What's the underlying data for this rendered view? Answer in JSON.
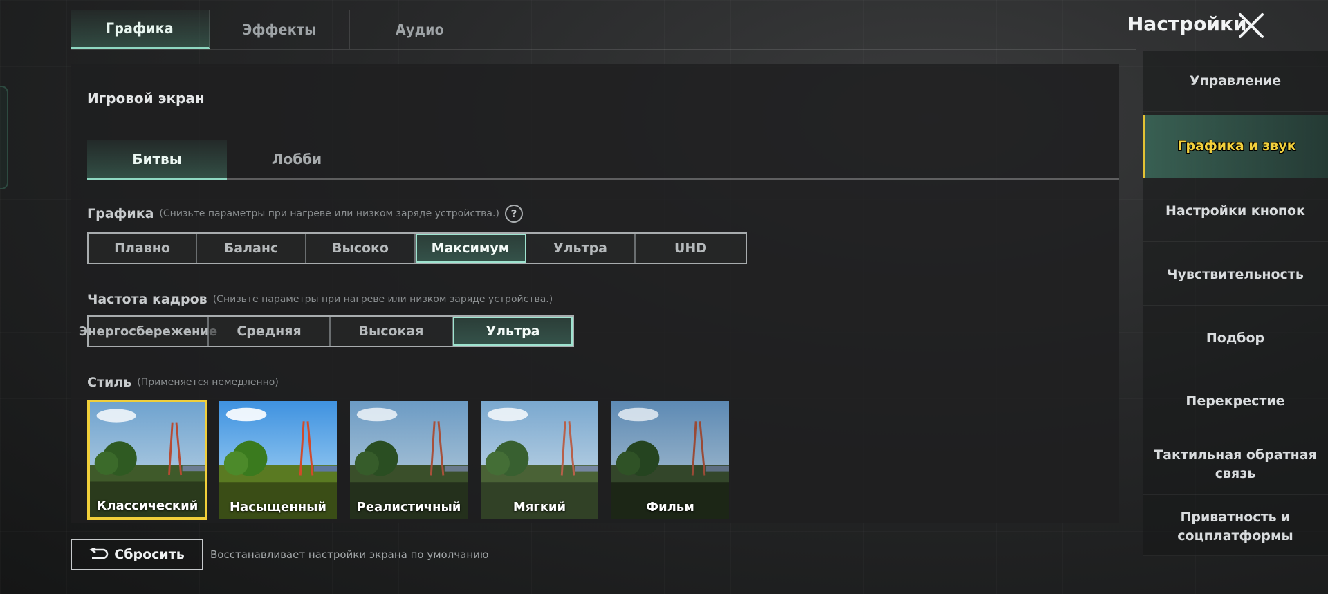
{
  "top_tabs": [
    {
      "label": "Графика",
      "active": true
    },
    {
      "label": "Эффекты",
      "active": false
    },
    {
      "label": "Аудио",
      "active": false
    }
  ],
  "header": {
    "title": "Настройки",
    "close_icon": "close-icon"
  },
  "panel": {
    "section_title": "Игровой экран",
    "sub_tabs": [
      {
        "label": "Битвы",
        "active": true
      },
      {
        "label": "Лобби",
        "active": false
      }
    ],
    "graphics": {
      "label": "Графика",
      "hint": "(Снизьте параметры при нагреве или низком заряде устройства.)",
      "options": [
        "Плавно",
        "Баланс",
        "Высоко",
        "Максимум",
        "Ультра",
        "UHD"
      ],
      "selected": "Максимум"
    },
    "fps": {
      "label": "Частота кадров",
      "hint": "(Снизьте параметры при нагреве или низком заряде устройства.)",
      "options": [
        "Энергосбережение",
        "Средняя",
        "Высокая",
        "Ультра"
      ],
      "selected": "Ультра"
    },
    "style": {
      "label": "Стиль",
      "hint": "(Применяется немедленно)",
      "options": [
        "Классический",
        "Насыщенный",
        "Реалистичный",
        "Мягкий",
        "Фильм"
      ],
      "selected": "Классический"
    }
  },
  "reset": {
    "label": "Сбросить",
    "note": "Восстанавливает настройки экрана по умолчанию"
  },
  "sidebar": {
    "items": [
      {
        "label": "Управление",
        "active": false
      },
      {
        "label": "Графика и звук",
        "active": true
      },
      {
        "label": "Настройки кнопок",
        "active": false
      },
      {
        "label": "Чувствительность",
        "active": false
      },
      {
        "label": "Подбор",
        "active": false
      },
      {
        "label": "Перекрестие",
        "active": false
      },
      {
        "label": "Тактильная обратная связь",
        "active": false
      },
      {
        "label": "Приватность и соцплатформы",
        "active": false
      }
    ]
  },
  "colors": {
    "accent_teal": "#8fd8c2",
    "selected_yellow": "#f0cf3a"
  }
}
